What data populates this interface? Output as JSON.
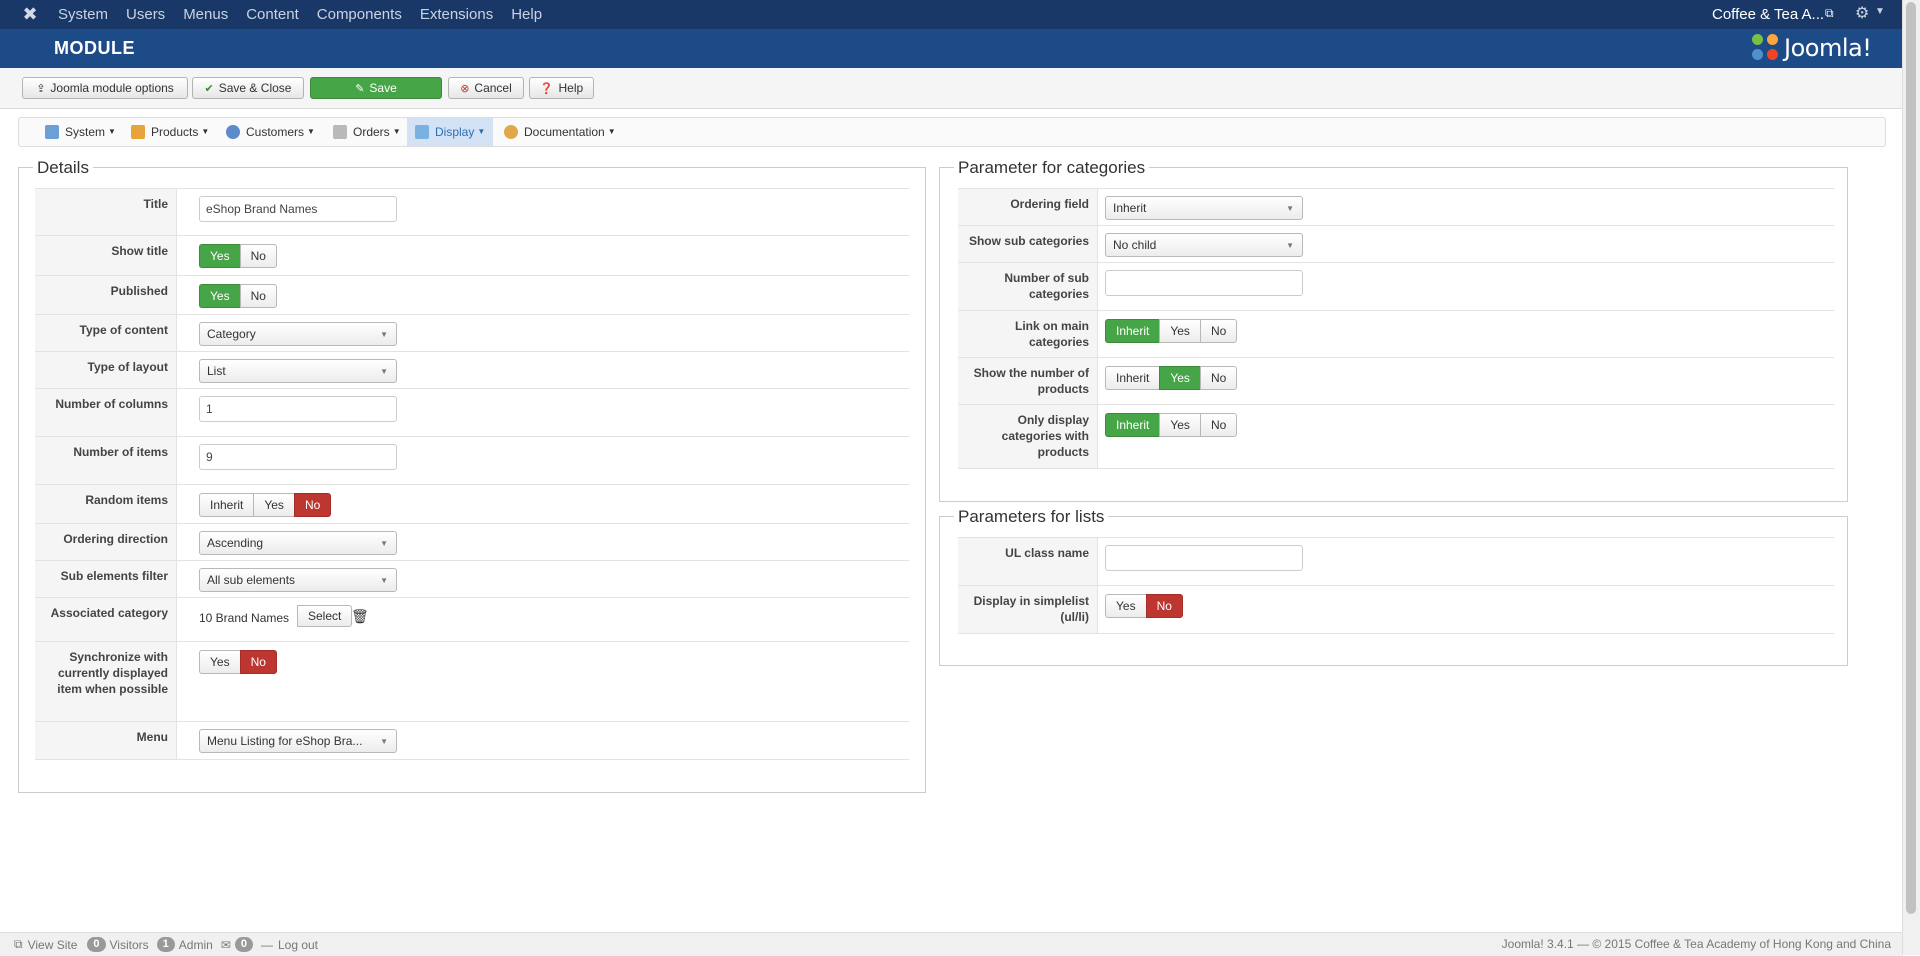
{
  "topnav": {
    "menu": [
      "System",
      "Users",
      "Menus",
      "Content",
      "Components",
      "Extensions",
      "Help"
    ],
    "site_name": "Coffee & Tea A..."
  },
  "header": {
    "title": "MODULE",
    "brand": "Joomla!"
  },
  "toolbar": {
    "options": "Joomla module options",
    "save_close": "Save & Close",
    "save": "Save",
    "cancel": "Cancel",
    "help": "Help"
  },
  "submenu": [
    "System",
    "Products",
    "Customers",
    "Orders",
    "Display",
    "Documentation"
  ],
  "details": {
    "legend": "Details",
    "title_label": "Title",
    "title_value": "eShop Brand Names",
    "show_title_label": "Show title",
    "published_label": "Published",
    "type_content_label": "Type of content",
    "type_content_value": "Category",
    "type_layout_label": "Type of layout",
    "type_layout_value": "List",
    "num_columns_label": "Number of columns",
    "num_columns_value": "1",
    "num_items_label": "Number of items",
    "num_items_value": "9",
    "random_label": "Random items",
    "ordering_dir_label": "Ordering direction",
    "ordering_dir_value": "Ascending",
    "sub_filter_label": "Sub elements filter",
    "sub_filter_value": "All sub elements",
    "assoc_cat_label": "Associated category",
    "assoc_cat_value": "10 Brand Names",
    "select_btn": "Select",
    "sync_label": "Synchronize with currently displayed item when possible",
    "menu_label": "Menu",
    "menu_value": "Menu Listing for eShop Bra..."
  },
  "btn": {
    "yes": "Yes",
    "no": "No",
    "inherit": "Inherit"
  },
  "categories": {
    "legend": "Parameter for categories",
    "ordering_label": "Ordering field",
    "ordering_value": "Inherit",
    "show_sub_label": "Show sub categories",
    "show_sub_value": "No child",
    "num_sub_label": "Number of sub categories",
    "link_main_label": "Link on main categories",
    "show_num_label": "Show the number of products",
    "only_display_label": "Only display categories with products"
  },
  "lists": {
    "legend": "Parameters for lists",
    "ul_class_label": "UL class name",
    "simplelist_label": "Display in simplelist (ul/li)"
  },
  "footer": {
    "view_site": "View Site",
    "visitors_count": "0",
    "visitors": "Visitors",
    "admin_count": "1",
    "admin": "Admin",
    "messages_count": "0",
    "logout": "Log out",
    "copyright": "Joomla! 3.4.1 — © 2015 Coffee & Tea Academy of Hong Kong and China"
  }
}
